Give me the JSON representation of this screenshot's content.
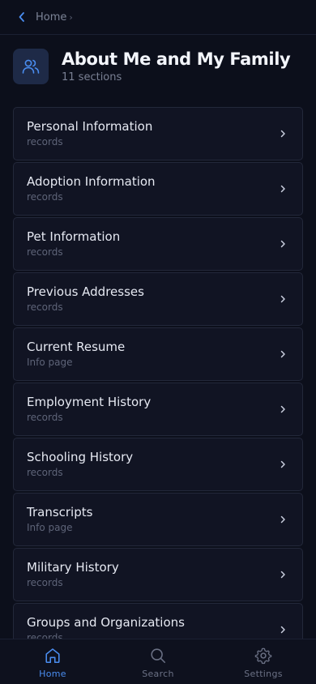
{
  "topbar": {
    "breadcrumb": "Home",
    "separator": "›"
  },
  "header": {
    "icon": "users-icon",
    "title": "About Me and My Family",
    "subtitle": "11 sections"
  },
  "sections": [
    {
      "title": "Personal Information",
      "subtitle": "records"
    },
    {
      "title": "Adoption Information",
      "subtitle": "records"
    },
    {
      "title": "Pet Information",
      "subtitle": "records"
    },
    {
      "title": "Previous Addresses",
      "subtitle": "records"
    },
    {
      "title": "Current Resume",
      "subtitle": "Info page"
    },
    {
      "title": "Employment History",
      "subtitle": "records"
    },
    {
      "title": "Schooling History",
      "subtitle": "records"
    },
    {
      "title": "Transcripts",
      "subtitle": "Info page"
    },
    {
      "title": "Military History",
      "subtitle": "records"
    },
    {
      "title": "Groups and Organizations",
      "subtitle": "records"
    }
  ],
  "tabbar": {
    "tabs": [
      {
        "label": "Home",
        "icon": "home-icon",
        "active": true
      },
      {
        "label": "Search",
        "icon": "search-icon",
        "active": false
      },
      {
        "label": "Settings",
        "icon": "gear-icon",
        "active": false
      }
    ]
  },
  "colors": {
    "accent": "#4a8df0",
    "background": "#0c0f1b",
    "card": "#111423"
  }
}
